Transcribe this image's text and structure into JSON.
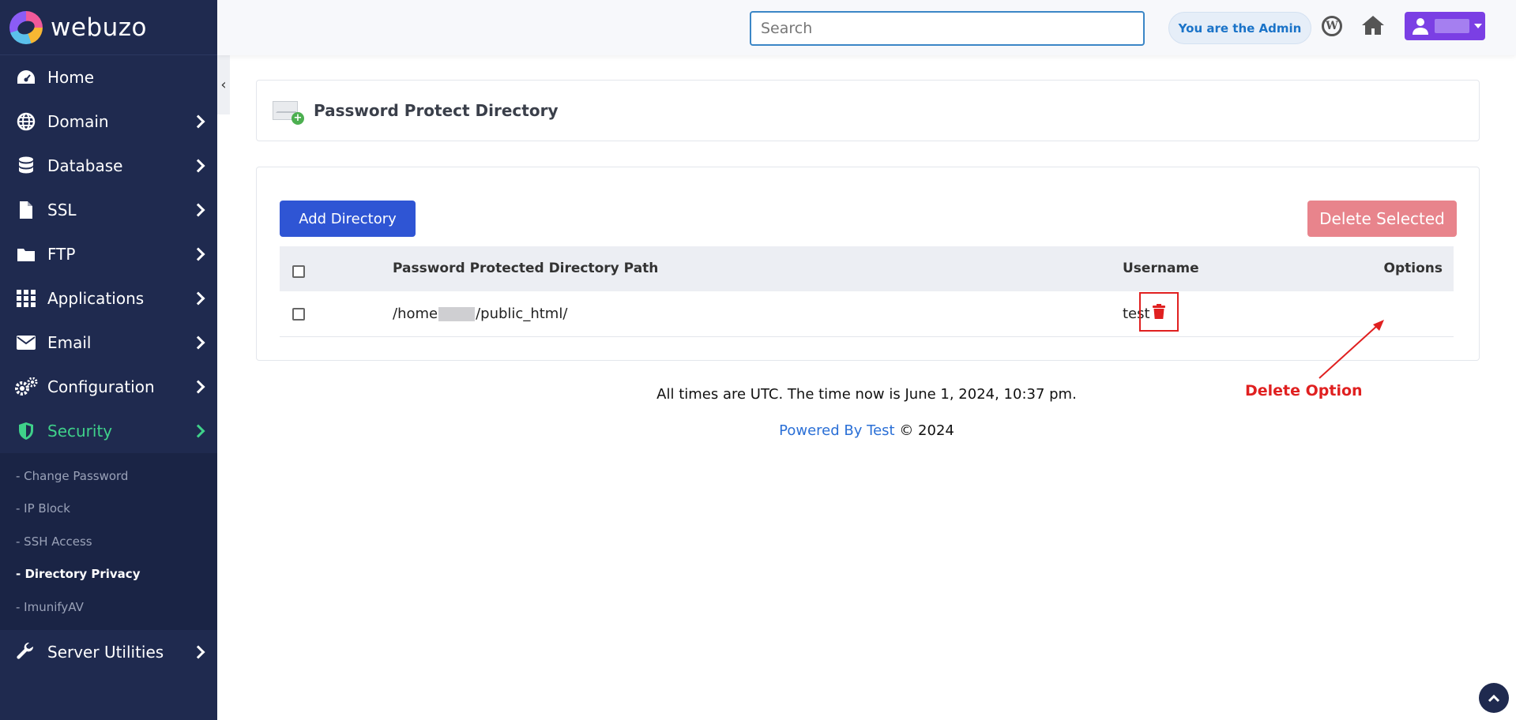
{
  "brand": {
    "name": "webuzo"
  },
  "header": {
    "search_placeholder": "Search",
    "admin_label": "You are the Admin",
    "wordpress_icon": "wordpress-icon",
    "home_icon": "home-icon",
    "user_icon": "user-icon"
  },
  "sidebar": {
    "items": [
      {
        "label": "Home",
        "icon": "dashboard-icon"
      },
      {
        "label": "Domain",
        "icon": "globe-icon"
      },
      {
        "label": "Database",
        "icon": "database-icon"
      },
      {
        "label": "SSL",
        "icon": "file-icon"
      },
      {
        "label": "FTP",
        "icon": "folder-icon"
      },
      {
        "label": "Applications",
        "icon": "grid-icon"
      },
      {
        "label": "Email",
        "icon": "envelope-icon"
      },
      {
        "label": "Configuration",
        "icon": "gears-icon"
      },
      {
        "label": "Security",
        "icon": "shield-icon"
      },
      {
        "label": "Server Utilities",
        "icon": "wrench-icon"
      }
    ],
    "security_sub": [
      {
        "label": "- Change Password"
      },
      {
        "label": "- IP Block"
      },
      {
        "label": "- SSH Access"
      },
      {
        "label": "- Directory Privacy"
      },
      {
        "label": "- ImunifyAV"
      }
    ],
    "collapse_label": "‹"
  },
  "page": {
    "title": "Password Protect Directory",
    "add_button": "Add Directory",
    "delete_selected_button": "Delete Selected",
    "columns": [
      "Password Protected Directory Path",
      "Username",
      "Options"
    ],
    "rows": [
      {
        "path_prefix": "/home",
        "path_suffix": "/public_html/",
        "username": "test"
      }
    ]
  },
  "annotation": {
    "text": "Delete Option"
  },
  "footer": {
    "time_text": "All times are UTC. The time now is June 1, 2024, 10:37 pm.",
    "powered_link": "Powered By Test",
    "copyright": "© 2024"
  },
  "colors": {
    "sidebar_bg": "#1f2a4f",
    "accent_blue": "#2f55d4",
    "active_green": "#3fd18a",
    "danger_red": "#e02020",
    "delete_button": "#e8848c"
  }
}
